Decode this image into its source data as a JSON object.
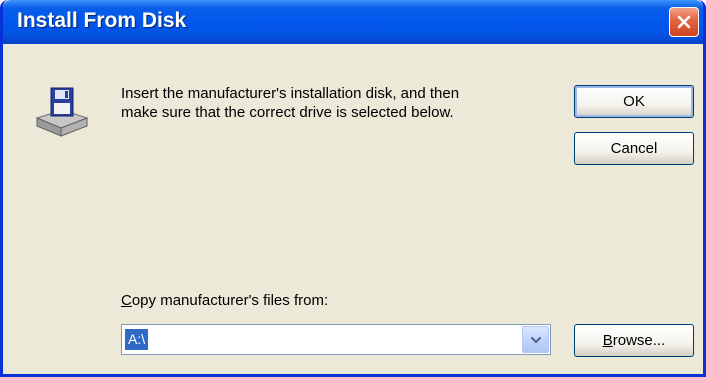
{
  "window": {
    "title": "Install From Disk"
  },
  "dialog": {
    "message_line1": "Insert the manufacturer's installation disk, and then",
    "message_line2": "make sure that the correct drive is selected below.",
    "icon": "floppy-drive-icon"
  },
  "buttons": {
    "ok_label": "OK",
    "cancel_label": "Cancel",
    "browse_mnemonic": "B",
    "browse_rest": "rowse..."
  },
  "copy_from": {
    "label_mnemonic": "C",
    "label_rest": "opy manufacturer's files from:",
    "value": "A:\\"
  },
  "colors": {
    "titlebar": "#0058ee",
    "dialog_bg": "#ece9d8",
    "selection": "#316ac5",
    "close_button": "#e2633f"
  }
}
